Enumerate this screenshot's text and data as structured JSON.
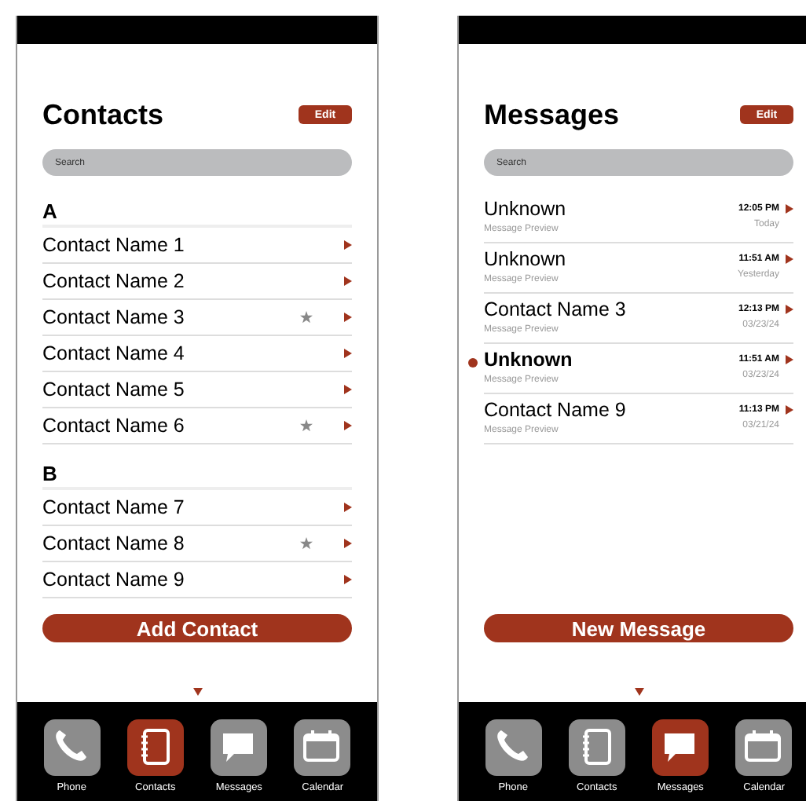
{
  "screens": [
    {
      "kind": "contacts",
      "title": "Contacts",
      "edit_button": "Edit",
      "search": {
        "placeholder": "Search"
      },
      "sections": [
        {
          "letter": "A",
          "contacts": [
            {
              "name": "Contact Name 1",
              "favorite": false
            },
            {
              "name": "Contact Name 2",
              "favorite": false
            },
            {
              "name": "Contact Name 3",
              "favorite": true
            },
            {
              "name": "Contact Name 4",
              "favorite": false
            },
            {
              "name": "Contact Name 5",
              "favorite": false
            },
            {
              "name": "Contact Name 6",
              "favorite": true
            }
          ]
        },
        {
          "letter": "B",
          "contacts": [
            {
              "name": "Contact Name 7",
              "favorite": false
            },
            {
              "name": "Contact Name 8",
              "favorite": true
            },
            {
              "name": "Contact Name 9",
              "favorite": false
            }
          ]
        }
      ],
      "action_button": "Add Contact",
      "dock": [
        {
          "label": "Phone",
          "kind": "phone",
          "selected": false
        },
        {
          "label": "Contacts",
          "kind": "contacts",
          "selected": true
        },
        {
          "label": "Messages",
          "kind": "messages",
          "selected": false
        },
        {
          "label": "Calendar",
          "kind": "calendar",
          "selected": false
        }
      ]
    },
    {
      "kind": "messages",
      "title": "Messages",
      "edit_button": "Edit",
      "search": {
        "placeholder": "Search"
      },
      "messages": [
        {
          "sender": "Unknown",
          "preview": "Message Preview",
          "time": "12:05 PM",
          "date": "Today",
          "unread": false
        },
        {
          "sender": "Unknown",
          "preview": "Message Preview",
          "time": "11:51 AM",
          "date": "Yesterday",
          "unread": false
        },
        {
          "sender": "Contact Name 3",
          "preview": "Message Preview",
          "time": "12:13 PM",
          "date": "03/23/24",
          "unread": false
        },
        {
          "sender": "Unknown",
          "preview": "Message Preview",
          "time": "11:51 AM",
          "date": "03/23/24",
          "unread": true
        },
        {
          "sender": "Contact Name 9",
          "preview": "Message Preview",
          "time": "11:13 PM",
          "date": "03/21/24",
          "unread": false
        }
      ],
      "action_button": "New Message",
      "dock": [
        {
          "label": "Phone",
          "kind": "phone",
          "selected": false
        },
        {
          "label": "Contacts",
          "kind": "contacts",
          "selected": false
        },
        {
          "label": "Messages",
          "kind": "messages",
          "selected": true
        },
        {
          "label": "Calendar",
          "kind": "calendar",
          "selected": false
        }
      ]
    }
  ]
}
